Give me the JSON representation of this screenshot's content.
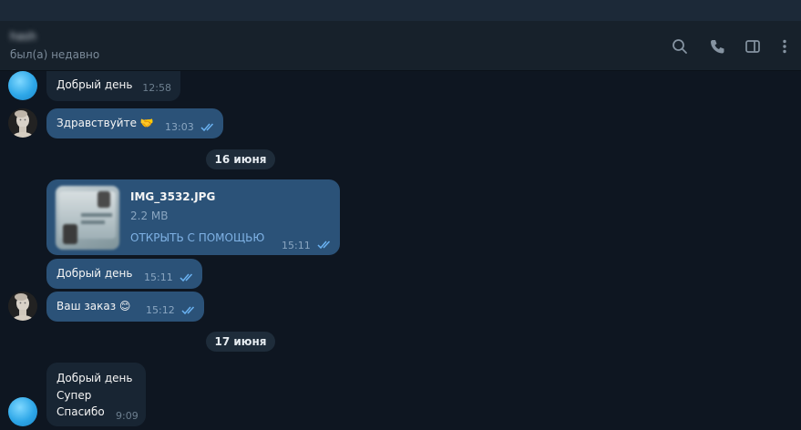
{
  "header": {
    "peer_name": "hash",
    "peer_status": "был(а) недавно",
    "icons": [
      "search-icon",
      "phone-icon",
      "sidebar-toggle-icon",
      "more-vertical-icon"
    ]
  },
  "colors": {
    "background": "#0e1621",
    "header": "#17212b",
    "outgoing_bubble": "#2b5278",
    "incoming_bubble": "#182533",
    "accent": "#7fb2e5"
  },
  "messages": [
    {
      "text": "Добрый день",
      "time": "12:58"
    },
    {
      "text": "Здравствуйте 🤝",
      "time": "13:03"
    },
    {
      "file": {
        "name": "IMG_3532.JPG",
        "size": "2.2 MB",
        "action": "ОТКРЫТЬ С ПОМОЩЬЮ"
      },
      "time": "15:11"
    },
    {
      "text": "Добрый день",
      "time": "15:11"
    },
    {
      "text": "Ваш заказ 😊",
      "time": "15:12"
    },
    {
      "lines": [
        "Добрый день",
        "Супер",
        "Спасибо"
      ],
      "time": "9:09"
    }
  ],
  "dates": [
    "16 июня",
    "17 июня"
  ]
}
